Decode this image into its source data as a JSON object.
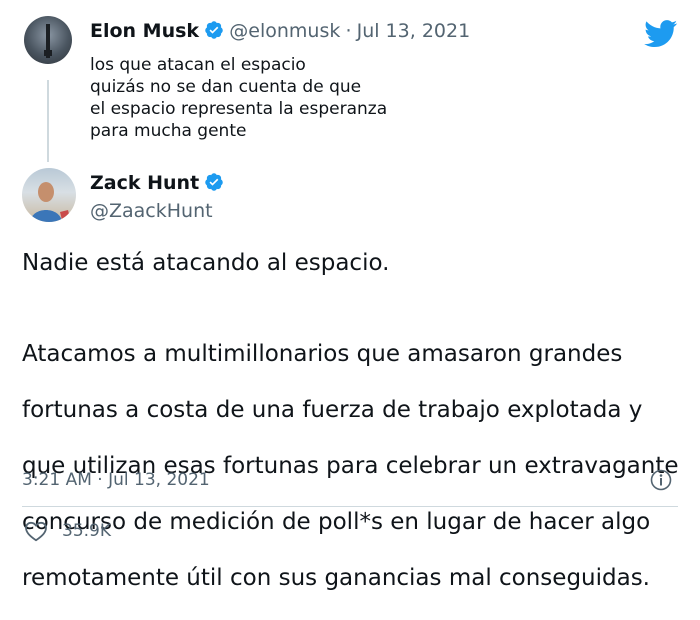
{
  "quoted_tweet": {
    "name": "Elon Musk",
    "handle": "@elonmusk",
    "date": "Jul 13, 2021",
    "separator": "·",
    "text_lines": [
      "los que atacan el espacio",
      "quizás no se dan cuenta de que",
      "el espacio representa la esperanza",
      "para mucha gente"
    ]
  },
  "tweet": {
    "name": "Zack Hunt",
    "handle": "@ZaackHunt",
    "paragraph_1": "Nadie está atacando al espacio.",
    "paragraph_2_lines": [
      "Atacamos a multimillonarios que amasaron grandes",
      "fortunas a costa de una fuerza de trabajo explotada y",
      "que utilizan esas fortunas para celebrar un extravagante",
      "concurso de medición de poll*s en lugar de hacer algo",
      "remotamente útil con sus ganancias mal conseguidas."
    ],
    "timestamp": "3:21 AM · Jul 13, 2021",
    "likes": "35.9K"
  },
  "icons": {
    "brand": "twitter-bird-icon",
    "verified": "verified-badge-icon",
    "info": "info-icon",
    "like": "heart-icon"
  },
  "colors": {
    "brand_blue": "#1d9bf0",
    "text": "#0f1419",
    "muted": "#536471",
    "border": "#cfd9de"
  }
}
